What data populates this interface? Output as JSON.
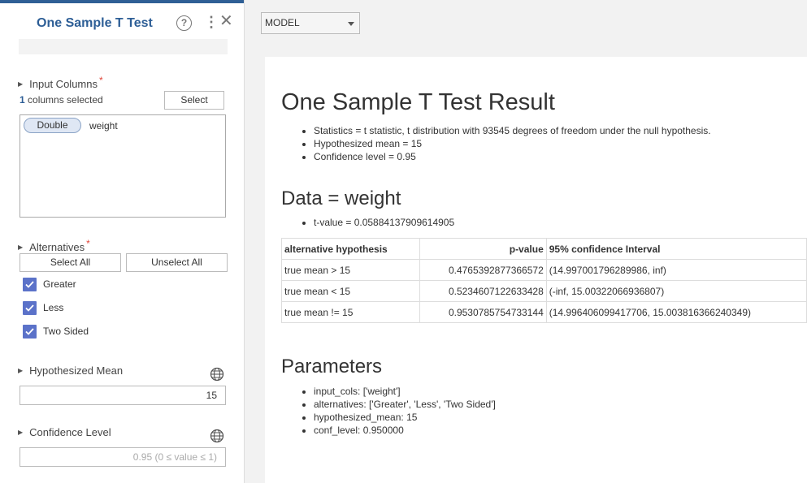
{
  "panel": {
    "title": "One Sample T Test",
    "sections": {
      "input_columns": "Input Columns",
      "alternatives": "Alternatives",
      "hypothesized_mean": "Hypothesized Mean",
      "confidence_level": "Confidence Level"
    },
    "required_mark": "*",
    "columns_selected_count": "1",
    "columns_selected_text": " columns selected",
    "select_button": "Select",
    "column_type": "Double",
    "column_name": "weight",
    "select_all_button": "Select All",
    "unselect_all_button": "Unselect All",
    "checkboxes": [
      {
        "label": "Greater",
        "checked": true
      },
      {
        "label": "Less",
        "checked": true
      },
      {
        "label": "Two Sided",
        "checked": true
      }
    ],
    "hypothesized_mean_value": "15",
    "confidence_level_placeholder": "0.95 (0 ≤ value ≤ 1)"
  },
  "model_select": {
    "value": "MODEL"
  },
  "result": {
    "title": "One Sample T Test Result",
    "summary": [
      "Statistics = t statistic, t distribution with 93545 degrees of freedom under the null hypothesis.",
      "Hypothesized mean = 15",
      "Confidence level = 0.95"
    ],
    "data_heading": "Data = weight",
    "t_value": "t-value = 0.05884137909614905",
    "table": {
      "headers": [
        "alternative hypothesis",
        "p-value",
        "95% confidence Interval"
      ],
      "rows": [
        [
          "true mean > 15",
          "0.4765392877366572",
          "(14.997001796289986, inf)"
        ],
        [
          "true mean < 15",
          "0.5234607122633428",
          "(-inf, 15.00322066936807)"
        ],
        [
          "true mean != 15",
          "0.9530785754733144",
          "(14.996406099417706, 15.003816366240349)"
        ]
      ]
    },
    "params_heading": "Parameters",
    "params": [
      "input_cols: ['weight']",
      "alternatives: ['Greater', 'Less', 'Two Sided']",
      "hypothesized_mean: 15",
      "conf_level: 0.950000"
    ]
  },
  "colors": {
    "accent": "#2f5f95",
    "checkbox": "#5b72c9",
    "required": "#e0463a"
  }
}
